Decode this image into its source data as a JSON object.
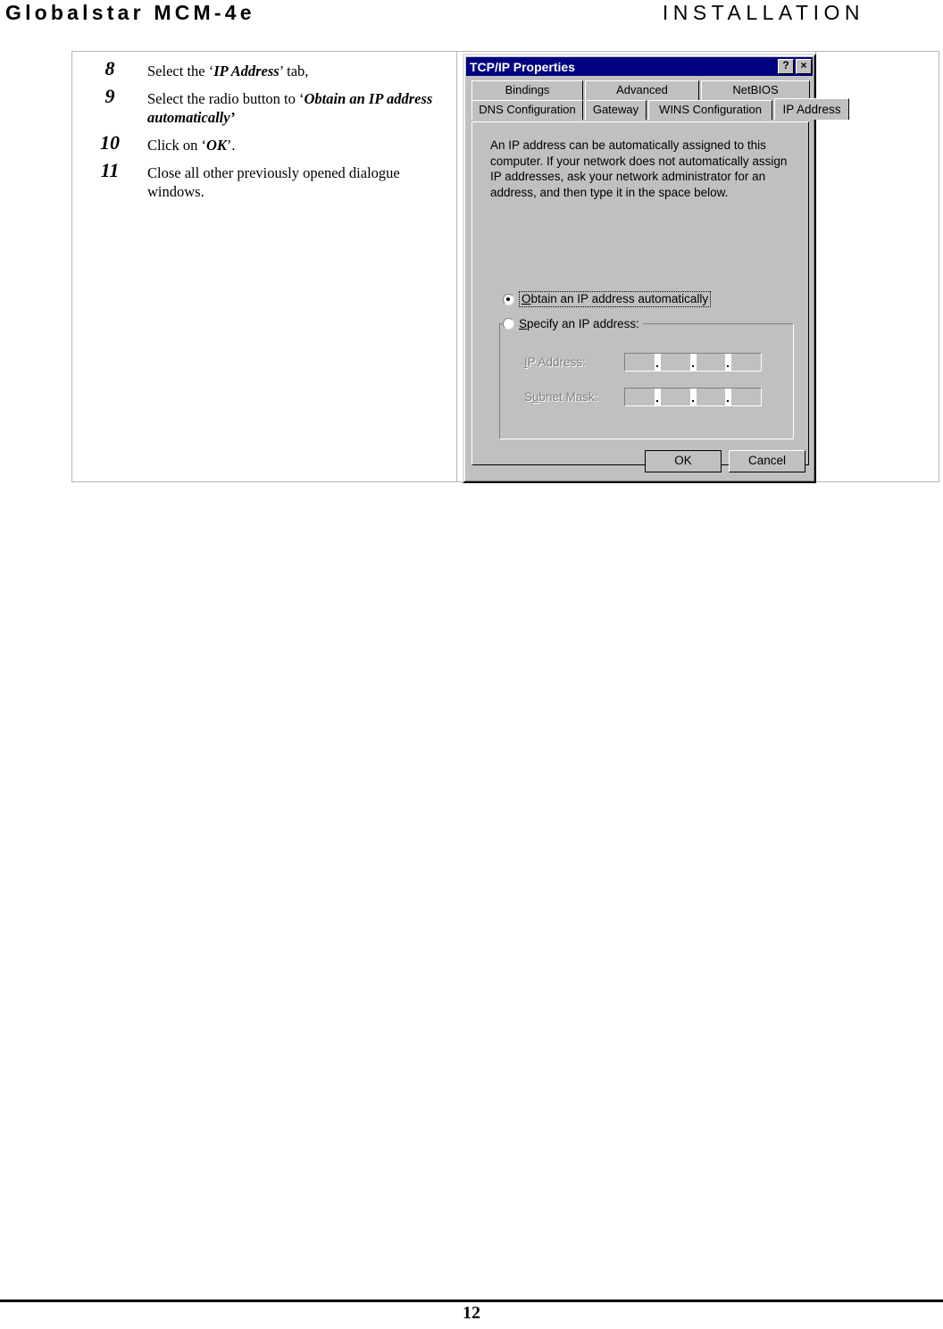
{
  "header": {
    "left_title": "Globalstar MCM-4e",
    "right_title": "INSTALLATION"
  },
  "steps": [
    {
      "number": "8",
      "parts": [
        {
          "t": "Select the ‘",
          "b": false
        },
        {
          "t": "IP Address",
          "b": true
        },
        {
          "t": "’ tab,",
          "b": false
        }
      ]
    },
    {
      "number": "9",
      "parts": [
        {
          "t": "Select the radio button to ‘",
          "b": false
        },
        {
          "t": "Obtain an IP address automatically’",
          "b": true
        }
      ]
    },
    {
      "number": "10",
      "parts": [
        {
          "t": "Click on ‘",
          "b": false
        },
        {
          "t": "OK",
          "b": true
        },
        {
          "t": "’.",
          "b": false
        }
      ]
    },
    {
      "number": "11",
      "parts": [
        {
          "t": "Close all other previously opened dialogue windows.",
          "b": false
        }
      ]
    }
  ],
  "dialog": {
    "title": "TCP/IP Properties",
    "help_button": "?",
    "close_button": "×",
    "tabs_top": [
      {
        "label": "Bindings",
        "active": false
      },
      {
        "label": "Advanced",
        "active": false
      },
      {
        "label": "NetBIOS",
        "active": false
      }
    ],
    "tabs_bottom": [
      {
        "label": "DNS Configuration",
        "active": false
      },
      {
        "label": "Gateway",
        "active": false
      },
      {
        "label": "WINS Configuration",
        "active": false
      },
      {
        "label": "IP Address",
        "active": true
      }
    ],
    "description": "An IP address can be automatically assigned to this computer. If your network does not automatically assign IP addresses, ask your network administrator for an address, and then type it in the space below.",
    "radio_auto": {
      "label_underlined": "O",
      "label_rest": "btain an IP address automatically",
      "selected": true,
      "focused": true
    },
    "radio_specify": {
      "label_underlined": "S",
      "label_rest": "pecify an IP address:",
      "selected": false,
      "focused": false
    },
    "ip_address_field": {
      "label_underlined": "I",
      "label_rest": "P Address:",
      "value": "",
      "disabled": true
    },
    "subnet_mask_field": {
      "label_pre": "S",
      "label_underlined": "u",
      "label_rest": "bnet Mask:",
      "value": "",
      "disabled": true
    },
    "ok_button": "OK",
    "cancel_button": "Cancel"
  },
  "footer": {
    "page_number": "12"
  },
  "colors": {
    "titlebar": "#000080",
    "dialog_face": "#c0c0c0",
    "disabled_text": "#808080",
    "table_border": "#b6b6b6"
  }
}
